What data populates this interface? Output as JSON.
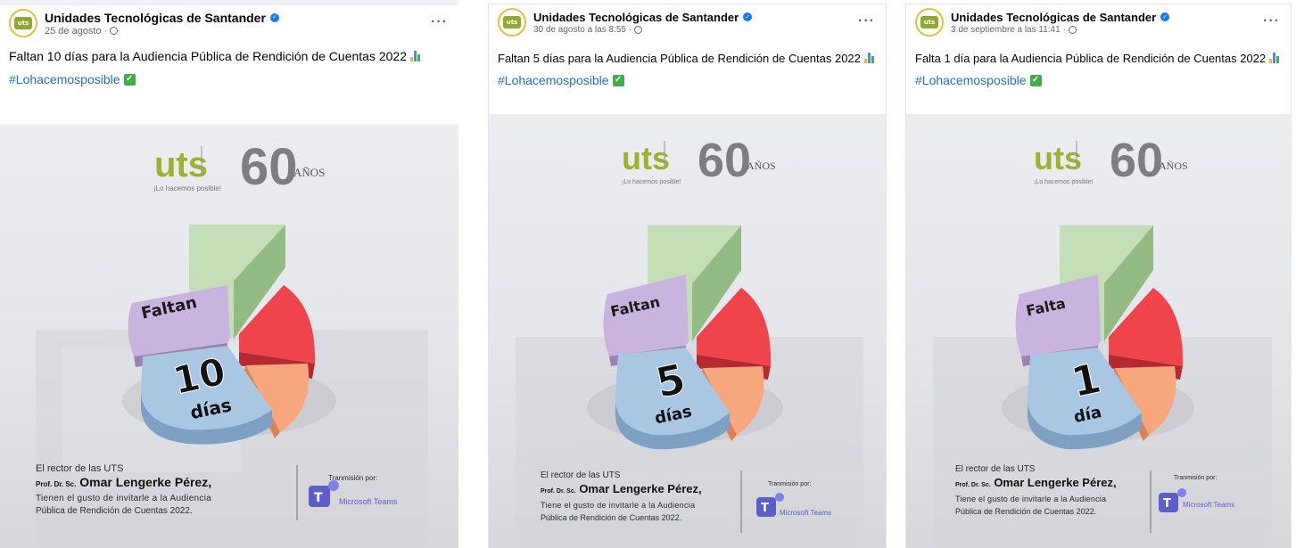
{
  "posts": [
    {
      "page_name": "Unidades Tecnológicas de Santander",
      "date": "25 de agosto ·",
      "text": "Faltan 10 días para la Audiencia Pública de Rendición de Cuentas 2022",
      "hashtag": "#Lohacemosposible",
      "more": "···",
      "image": {
        "logo_text": "uts",
        "logo_sub": "Unidades Tecnológicas de Santander",
        "slogan": "¡Lo hacemos posible!",
        "anniversary": "60",
        "anniversary_word": "AÑOS",
        "word_top": "Faltan",
        "count": "10",
        "unit": "días",
        "intro": "El rector de las UTS",
        "rector_title": "Prof. Dr. Sc.",
        "rector_name": "Omar Lengerke Pérez,",
        "invite_line1": "Tienen el gusto de invitarle a la Audiencia",
        "invite_line2": "Pública de Rendición de Cuentas 2022.",
        "broadcast_label": "Tranmisión por:",
        "platform": "Microsoft Teams"
      }
    },
    {
      "page_name": "Unidades Tecnológicas de Santander",
      "date": "30 de agosto a las 8:55 ·",
      "text": "Faltan 5 días para la Audiencia Pública de Rendición de Cuentas 2022",
      "hashtag": "#Lohacemosposible",
      "more": "···",
      "image": {
        "logo_text": "uts",
        "logo_sub": "Unidades Tecnológicas de Santander",
        "slogan": "¡Lo hacemos posible!",
        "anniversary": "60",
        "anniversary_word": "AÑOS",
        "word_top": "Faltan",
        "count": "5",
        "unit": "días",
        "intro": "El rector de las UTS",
        "rector_title": "Prof. Dr. Sc.",
        "rector_name": "Omar Lengerke Pérez,",
        "invite_line1": "Tiene el gusto de invitarle a la Audiencia",
        "invite_line2": "Pública de Rendición de Cuentas 2022.",
        "broadcast_label": "Tranmisión por:",
        "platform": "Microsoft Teams"
      }
    },
    {
      "page_name": "Unidades Tecnológicas de Santander",
      "date": "3 de septiembre a las 11:41 ·",
      "text": "Falta 1 día para la Audiencia Pública de Rendición de Cuentas 2022",
      "hashtag": "#Lohacemosposible",
      "more": "···",
      "image": {
        "logo_text": "uts",
        "logo_sub": "Unidades Tecnológicas de Santander",
        "slogan": "¡Lo hacemos posible!",
        "anniversary": "60",
        "anniversary_word": "AÑOS",
        "word_top": "Falta",
        "count": "1",
        "unit": "día",
        "intro": "El rector de las UTS",
        "rector_title": "Prof. Dr. Sc.",
        "rector_name": "Omar Lengerke Pérez,",
        "invite_line1": "Tiene el gusto de invitarle a la Audiencia",
        "invite_line2": "Pública de Rendición de Cuentas 2022.",
        "broadcast_label": "Tranmisión por:",
        "platform": "Microsoft Teams"
      }
    }
  ],
  "colors": {
    "link": "#216fdb",
    "verified": "#1877f2",
    "logo_green": "#9bb22e",
    "slice_green": "#b7d8a8",
    "slice_red": "#f0444c",
    "slice_orange": "#f6a77e",
    "slice_purple": "#c8b3de",
    "slice_blue": "#a9c6e2",
    "teams_purple": "#5b5fc7"
  }
}
